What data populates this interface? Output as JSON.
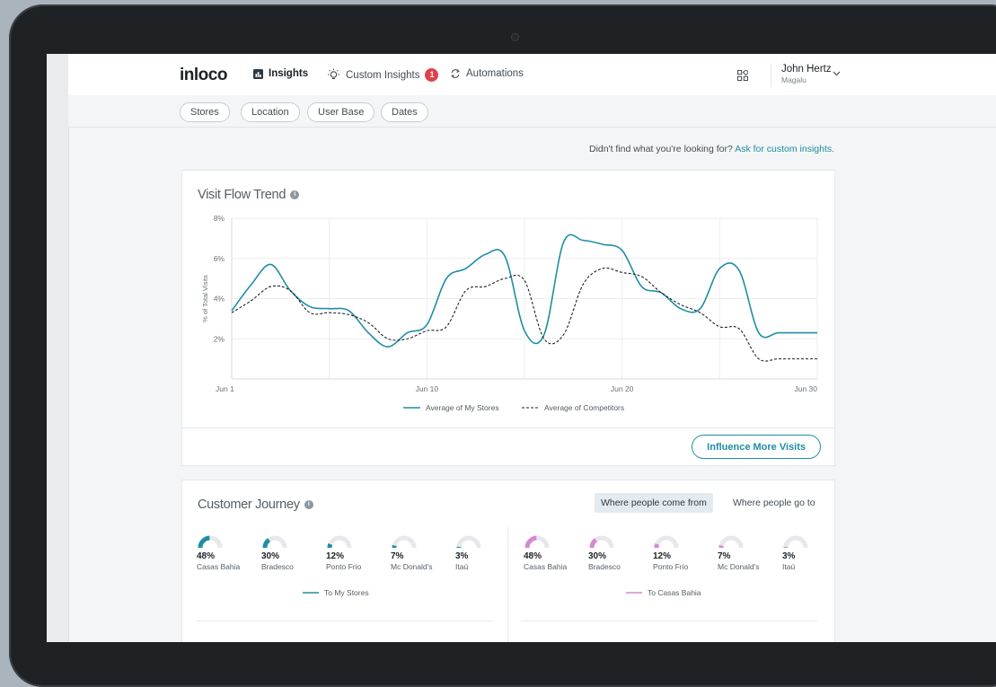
{
  "brand": {
    "logo": "inloco",
    "accent": "#1e8ea4",
    "secondary_accent": "#d688d4",
    "badge_color": "#e0404a"
  },
  "nav": {
    "items": [
      {
        "label": "Insights",
        "icon": "bar-chart-icon",
        "active": true
      },
      {
        "label": "Custom Insights",
        "icon": "lightbulb-icon",
        "badge": "1"
      },
      {
        "label": "Automations",
        "icon": "refresh-icon"
      }
    ],
    "user": {
      "name": "John Hertz",
      "org": "Magalu"
    }
  },
  "filters": [
    "Stores",
    "Location",
    "User Base",
    "Dates"
  ],
  "helper": {
    "text": "Didn't find what you're looking for? ",
    "link": "Ask for custom insights."
  },
  "visit_flow": {
    "title": "Visit Flow Trend",
    "cta": "Influence More Visits"
  },
  "chart_data": {
    "type": "line",
    "title": "Visit Flow Trend",
    "xlabel": "",
    "ylabel": "% of Total Visits",
    "x_tick_labels": [
      "Jun 1",
      "Jun 10",
      "Jun 20",
      "Jun 30"
    ],
    "x_tick_positions": [
      1,
      11,
      21,
      31
    ],
    "y_tick_labels": [
      "2%",
      "4%",
      "6%",
      "8%"
    ],
    "y_ticks": [
      2,
      4,
      6,
      8
    ],
    "xlim": [
      1,
      31
    ],
    "ylim": [
      0,
      8
    ],
    "grid": true,
    "legend_position": "bottom",
    "series": [
      {
        "name": "Average of My Stores",
        "style": "solid",
        "color": "#1e8ea4",
        "x": [
          1,
          2,
          3,
          4,
          5,
          6,
          7,
          8,
          9,
          10,
          11,
          12,
          13,
          14,
          15,
          16,
          17,
          18,
          19,
          20,
          21,
          22,
          23,
          24,
          25,
          26,
          27,
          28,
          29,
          30,
          31
        ],
        "values": [
          3.4,
          4.7,
          5.7,
          4.4,
          3.6,
          3.5,
          3.4,
          2.3,
          1.6,
          2.3,
          2.7,
          5.0,
          5.5,
          6.2,
          6.1,
          2.4,
          2.2,
          6.8,
          6.9,
          6.7,
          6.4,
          4.6,
          4.3,
          3.5,
          3.5,
          5.5,
          5.4,
          2.3,
          2.3,
          2.3,
          2.3
        ]
      },
      {
        "name": "Average of Competitors",
        "style": "dashed",
        "color": "#1d2226",
        "x": [
          1,
          2,
          3,
          4,
          5,
          6,
          7,
          8,
          9,
          10,
          11,
          12,
          13,
          14,
          15,
          16,
          17,
          18,
          19,
          20,
          21,
          22,
          23,
          24,
          25,
          26,
          27,
          28,
          29,
          30,
          31
        ],
        "values": [
          3.3,
          3.9,
          4.6,
          4.4,
          3.3,
          3.3,
          3.2,
          2.8,
          2.0,
          2.0,
          2.4,
          2.6,
          4.4,
          4.6,
          5.0,
          4.9,
          2.0,
          2.2,
          4.7,
          5.5,
          5.3,
          5.1,
          4.3,
          3.7,
          3.3,
          2.6,
          2.5,
          1.0,
          1.0,
          1.0,
          1.0
        ]
      }
    ]
  },
  "journey": {
    "title": "Customer Journey",
    "toggles": [
      {
        "label": "Where people come from",
        "active": true
      },
      {
        "label": "Where people go to",
        "active": false
      }
    ],
    "left": {
      "legend": "To My Stores",
      "color": "#1e8ea4",
      "items": [
        {
          "pct": "48%",
          "value": 48,
          "name": "Casas Bahia"
        },
        {
          "pct": "30%",
          "value": 30,
          "name": "Bradesco"
        },
        {
          "pct": "12%",
          "value": 12,
          "name": "Ponto Frio"
        },
        {
          "pct": "7%",
          "value": 7,
          "name": "Mc Donald's"
        },
        {
          "pct": "3%",
          "value": 3,
          "name": "Itaú"
        }
      ]
    },
    "right": {
      "legend": "To Casas Bahia",
      "color": "#d688d4",
      "items": [
        {
          "pct": "48%",
          "value": 48,
          "name": "Casas Bahia"
        },
        {
          "pct": "30%",
          "value": 30,
          "name": "Bradesco"
        },
        {
          "pct": "12%",
          "value": 12,
          "name": "Ponto Frio"
        },
        {
          "pct": "7%",
          "value": 7,
          "name": "Mc Donald's"
        },
        {
          "pct": "3%",
          "value": 3,
          "name": "Itaú"
        }
      ]
    }
  }
}
